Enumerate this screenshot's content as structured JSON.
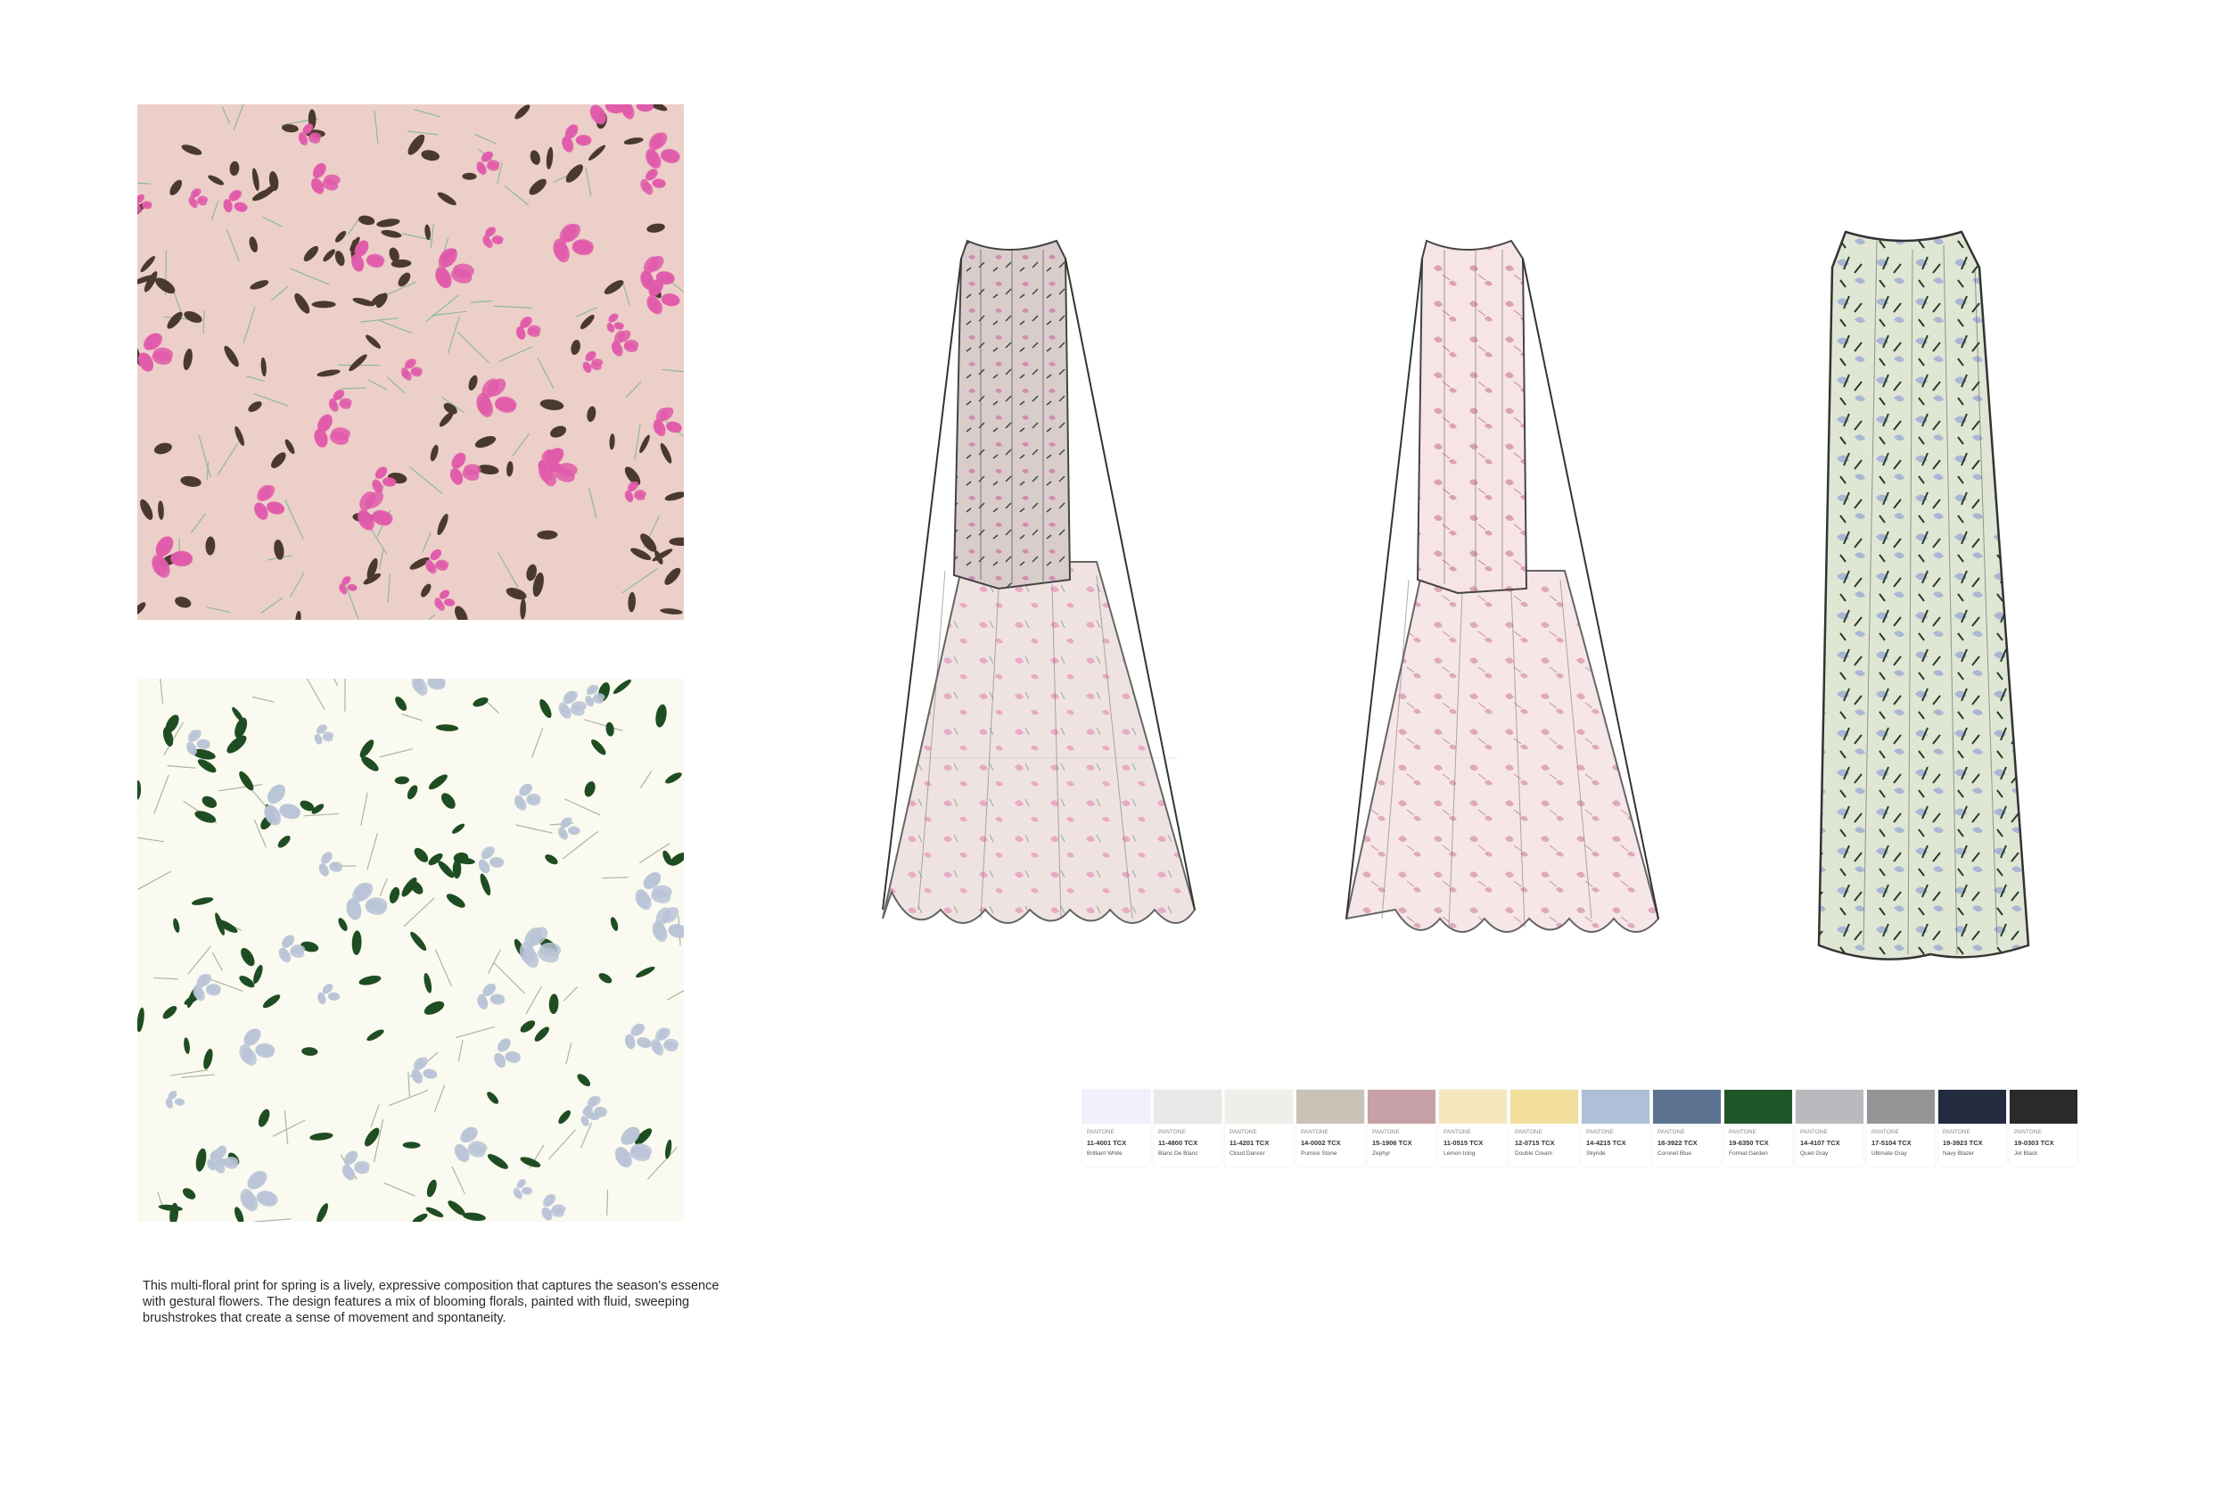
{
  "description": "This multi-floral print for spring is a lively, expressive composition that captures the season's essence with gestural flowers. The design features a mix of blooming florals, painted with fluid, sweeping brushstrokes that create a sense of movement and spontaneity.",
  "description_lines": [
    "This multi-floral print for spring is a lively, expressive composition that captures the season's essence",
    "with gestural flowers. The design features a mix of blooming florals, painted with fluid, sweeping",
    "brushstrokes that create a sense of movement and spontaneity."
  ],
  "prints": {
    "pink": {
      "background": "#eccfc8",
      "flower": "#e05aaa",
      "leaf": "#4a3a2e",
      "stem": "#8fb89a"
    },
    "cream": {
      "background": "#fbfaf0",
      "flower": "#b8c3d6",
      "leaf": "#1f4d22",
      "stem": "#a9b5a3"
    }
  },
  "palette": [
    {
      "brand": "PANTONE",
      "code": "11-4001 TCX",
      "name": "Brilliant White",
      "hex": "#eff0fb"
    },
    {
      "brand": "PANTONE",
      "code": "11-4800 TCX",
      "name": "Blanc De Blanc",
      "hex": "#e7e9e6"
    },
    {
      "brand": "PANTONE",
      "code": "11-4201 TCX",
      "name": "Cloud Dancer",
      "hex": "#efefea"
    },
    {
      "brand": "PANTONE",
      "code": "14-0002 TCX",
      "name": "Pumice Stone",
      "hex": "#cac2b7"
    },
    {
      "brand": "PANTONE",
      "code": "15-1906 TCX",
      "name": "Zephyr",
      "hex": "#c8a0a7"
    },
    {
      "brand": "PANTONE",
      "code": "11-0515 TCX",
      "name": "Lemon Icing",
      "hex": "#f5e8bf"
    },
    {
      "brand": "PANTONE",
      "code": "12-0715 TCX",
      "name": "Double Cream",
      "hex": "#f2df9e"
    },
    {
      "brand": "PANTONE",
      "code": "14-4215 TCX",
      "name": "Skyride",
      "hex": "#afbfd7"
    },
    {
      "brand": "PANTONE",
      "code": "18-3922 TCX",
      "name": "Coronet Blue",
      "hex": "#5b7391"
    },
    {
      "brand": "PANTONE",
      "code": "19-6350 TCX",
      "name": "Formal Garden",
      "hex": "#1f5628"
    },
    {
      "brand": "PANTONE",
      "code": "14-4107 TCX",
      "name": "Quiet Gray",
      "hex": "#b9babd"
    },
    {
      "brand": "PANTONE",
      "code": "17-5104 TCX",
      "name": "Ultimate Gray",
      "hex": "#939597"
    },
    {
      "brand": "PANTONE",
      "code": "19-3923 TCX",
      "name": "Navy Blazer",
      "hex": "#232b3f"
    },
    {
      "brand": "PANTONE",
      "code": "19-0303 TCX",
      "name": "Jet Black",
      "hex": "#2b2a2b"
    }
  ]
}
